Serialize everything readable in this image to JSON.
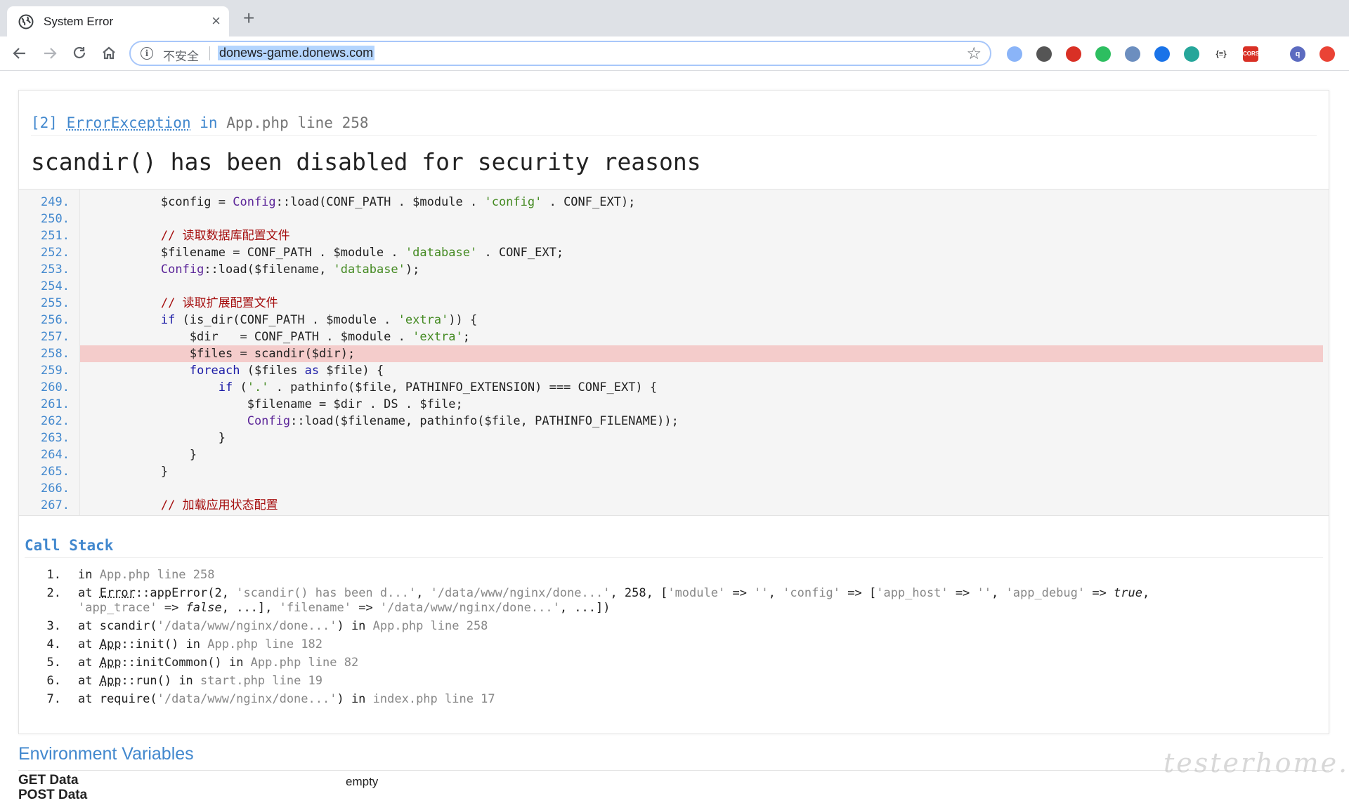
{
  "browser": {
    "tab_title": "System Error",
    "tab_close": "×",
    "new_tab": "+",
    "insecure_label": "不安全",
    "url": "donews-game.donews.com",
    "extensions": [
      {
        "name": "ext-1",
        "label": "",
        "color": "#8ab4f8"
      },
      {
        "name": "ext-2",
        "label": "",
        "color": "#555555"
      },
      {
        "name": "ext-3",
        "label": "",
        "color": "#d93025"
      },
      {
        "name": "ext-evernote",
        "label": "",
        "color": "#2dbe60"
      },
      {
        "name": "ext-5",
        "label": "",
        "color": "#6c8ebf"
      },
      {
        "name": "ext-6",
        "label": "",
        "color": "#1a73e8"
      },
      {
        "name": "ext-7",
        "label": "",
        "color": "#26a69a"
      },
      {
        "name": "ext-json",
        "label": "{≡}",
        "color": "#ffffff"
      },
      {
        "name": "ext-cors",
        "label": "CORS",
        "color": "#d93025"
      },
      {
        "name": "ext-profile",
        "label": "q",
        "color": "#5c6bc0"
      },
      {
        "name": "ext-update",
        "label": "",
        "color": "#ea4335"
      }
    ]
  },
  "exception": {
    "code": "[2]",
    "class": "ErrorException",
    "in_word": "in",
    "location": "App.php line 258",
    "message": "scandir() has been disabled for security reasons"
  },
  "source": {
    "highlight_line": 258,
    "lines": [
      {
        "n": "249.",
        "code": "        $config = Config::load(CONF_PATH . $module . 'config' . CONF_EXT);"
      },
      {
        "n": "250.",
        "code": ""
      },
      {
        "n": "251.",
        "code": "        // 读取数据库配置文件"
      },
      {
        "n": "252.",
        "code": "        $filename = CONF_PATH . $module . 'database' . CONF_EXT;"
      },
      {
        "n": "253.",
        "code": "        Config::load($filename, 'database');"
      },
      {
        "n": "254.",
        "code": ""
      },
      {
        "n": "255.",
        "code": "        // 读取扩展配置文件"
      },
      {
        "n": "256.",
        "code": "        if (is_dir(CONF_PATH . $module . 'extra')) {"
      },
      {
        "n": "257.",
        "code": "            $dir   = CONF_PATH . $module . 'extra';"
      },
      {
        "n": "258.",
        "code": "            $files = scandir($dir);"
      },
      {
        "n": "259.",
        "code": "            foreach ($files as $file) {"
      },
      {
        "n": "260.",
        "code": "                if ('.' . pathinfo($file, PATHINFO_EXTENSION) === CONF_EXT) {"
      },
      {
        "n": "261.",
        "code": "                    $filename = $dir . DS . $file;"
      },
      {
        "n": "262.",
        "code": "                    Config::load($filename, pathinfo($file, PATHINFO_FILENAME));"
      },
      {
        "n": "263.",
        "code": "                }"
      },
      {
        "n": "264.",
        "code": "            }"
      },
      {
        "n": "265.",
        "code": "        }"
      },
      {
        "n": "266.",
        "code": ""
      },
      {
        "n": "267.",
        "code": "        // 加载应用状态配置"
      }
    ]
  },
  "call_stack": {
    "title": "Call Stack",
    "items": [
      {
        "n": "1.",
        "parts": [
          [
            "",
            "in "
          ],
          [
            "grey",
            "App.php line 258"
          ]
        ]
      },
      {
        "n": "2.",
        "parts": [
          [
            "",
            "at "
          ],
          [
            "dot",
            "Error"
          ],
          [
            "",
            "::appError(2, "
          ],
          [
            "grey",
            "'scandir() has been d...'"
          ],
          [
            "",
            ", "
          ],
          [
            "grey",
            "'/data/www/nginx/done...'"
          ],
          [
            "",
            ", 258, ["
          ],
          [
            "grey",
            "'module'"
          ],
          [
            "",
            " => "
          ],
          [
            "grey",
            "''"
          ],
          [
            "",
            ", "
          ],
          [
            "grey",
            "'config'"
          ],
          [
            "",
            " => ["
          ],
          [
            "grey",
            "'app_host'"
          ],
          [
            "",
            " => "
          ],
          [
            "grey",
            "''"
          ],
          [
            "",
            ", "
          ],
          [
            "grey",
            "'app_debug'"
          ],
          [
            "",
            " => "
          ],
          [
            "it",
            "true"
          ],
          [
            "",
            ",\n"
          ],
          [
            "grey",
            "'app_trace'"
          ],
          [
            "",
            " => "
          ],
          [
            "it",
            "false"
          ],
          [
            "",
            ", ...], "
          ],
          [
            "grey",
            "'filename'"
          ],
          [
            "",
            " => "
          ],
          [
            "grey",
            "'/data/www/nginx/done...'"
          ],
          [
            "",
            ", ...])"
          ]
        ]
      },
      {
        "n": "3.",
        "parts": [
          [
            "",
            "at scandir("
          ],
          [
            "grey",
            "'/data/www/nginx/done...'"
          ],
          [
            "",
            ") in "
          ],
          [
            "grey",
            "App.php line 258"
          ]
        ]
      },
      {
        "n": "4.",
        "parts": [
          [
            "",
            "at "
          ],
          [
            "dot",
            "App"
          ],
          [
            "",
            "::init() in "
          ],
          [
            "grey",
            "App.php line 182"
          ]
        ]
      },
      {
        "n": "5.",
        "parts": [
          [
            "",
            "at "
          ],
          [
            "dot",
            "App"
          ],
          [
            "",
            "::initCommon() in "
          ],
          [
            "grey",
            "App.php line 82"
          ]
        ]
      },
      {
        "n": "6.",
        "parts": [
          [
            "",
            "at "
          ],
          [
            "dot",
            "App"
          ],
          [
            "",
            "::run() in "
          ],
          [
            "grey",
            "start.php line 19"
          ]
        ]
      },
      {
        "n": "7.",
        "parts": [
          [
            "",
            "at require("
          ],
          [
            "grey",
            "'/data/www/nginx/done...'"
          ],
          [
            "",
            ") in "
          ],
          [
            "grey",
            "index.php line 17"
          ]
        ]
      }
    ]
  },
  "environment": {
    "title": "Environment Variables",
    "get_label": "GET Data",
    "get_value": "empty",
    "post_label": "POST Data"
  },
  "watermark": "testerhome.com"
}
